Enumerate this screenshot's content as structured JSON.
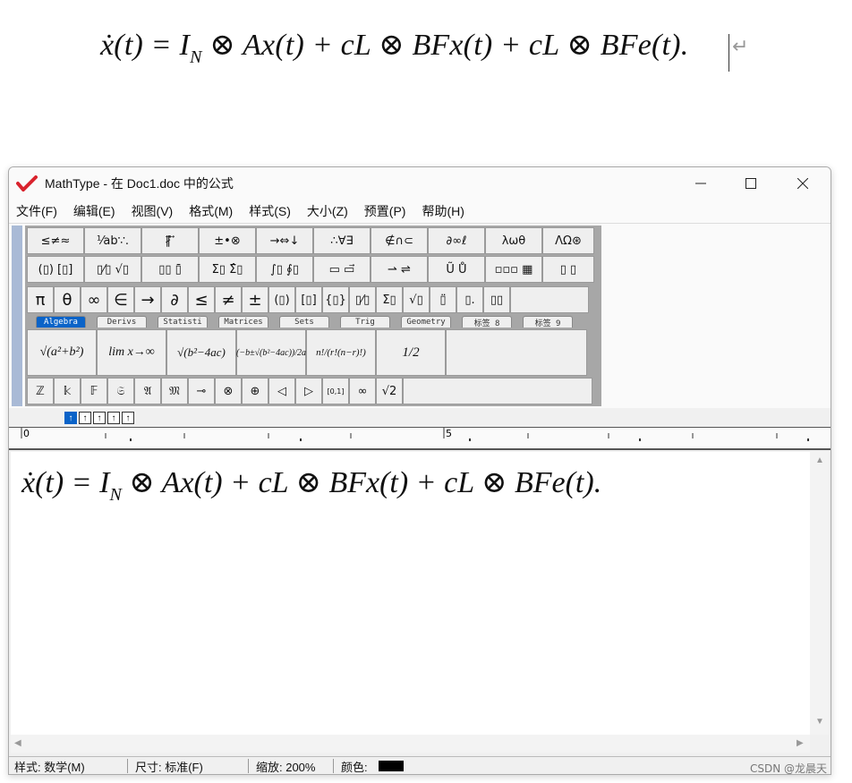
{
  "document": {
    "formula": [
      "ẋ(t) = I",
      "N",
      " ⊗ Ax(t) + cL ⊗ BFx(t) + cL ⊗ BFe(t)."
    ],
    "para_mark": "↵"
  },
  "window": {
    "title": "MathType - 在 Doc1.doc 中的公式",
    "logo_icon": "mathtype-logo-icon",
    "controls": {
      "minimize": "—",
      "maximize": "☐",
      "close": "✕"
    }
  },
  "menu": [
    "文件(F)",
    "编辑(E)",
    "视图(V)",
    "格式(M)",
    "样式(S)",
    "大小(Z)",
    "预置(P)",
    "帮助(H)"
  ],
  "palette": {
    "row1": [
      "≤≠≈",
      "⅟ab∵.",
      "∦⃗ ⃡",
      "±•⊗",
      "→⇔↓",
      "∴∀∃",
      "∉∩⊂",
      "∂∞ℓ",
      "λωθ",
      "ΛΩ⊛"
    ],
    "row2": [
      "(▯) [▯]",
      "▯⁄▯ √▯",
      "▯▯ ▯̄",
      "Σ▯ Σ̂▯",
      "∫▯ ∮▯",
      "▭ ▭⃗",
      "⇀ ⇌",
      "Ũ Ů",
      "▫▫▫ ▦",
      "▯ ▯"
    ],
    "row3": [
      "π",
      "θ",
      "∞",
      "∈",
      "→",
      "∂",
      "≤",
      "≠",
      "±",
      "(▯)",
      "[▯]",
      "{▯}",
      "▯⁄▯",
      "Σ▯",
      "√▯",
      "▯̈",
      "▯.",
      "▯▯",
      ""
    ],
    "tabs": [
      "Algebra",
      "Derivs",
      "Statisti",
      "Matrices",
      "Sets",
      "Trig",
      "Geometry",
      "标签 8",
      "标签 9"
    ],
    "templates": [
      "√(a²+b²)",
      "lim x→∞",
      "√(b²−4ac)",
      "(−b±√(b²−4ac))/2a",
      "n!/(r!(n−r)!)",
      "1/2",
      ""
    ],
    "row5": [
      "ℤ",
      "𝕜",
      "𝔽",
      "𝔖",
      "𝔄",
      "𝔐",
      "⊸",
      "⊗",
      "⊕",
      "◁",
      "▷",
      "[0,1]",
      "∞",
      "√2",
      ""
    ]
  },
  "ruler": {
    "zero": "0",
    "five": "5"
  },
  "editor": {
    "formula": [
      "ẋ(t) = I",
      "N",
      " ⊗ Ax(t) + cL ⊗ BFx(t) + cL ⊗ BFe(t)."
    ]
  },
  "status": {
    "style": "样式: 数学(M)",
    "size": "尺寸: 标准(F)",
    "zoom": "缩放: 200%",
    "color": "颜色:",
    "color_value": "#000000"
  },
  "watermark": "CSDN @龙晨天"
}
